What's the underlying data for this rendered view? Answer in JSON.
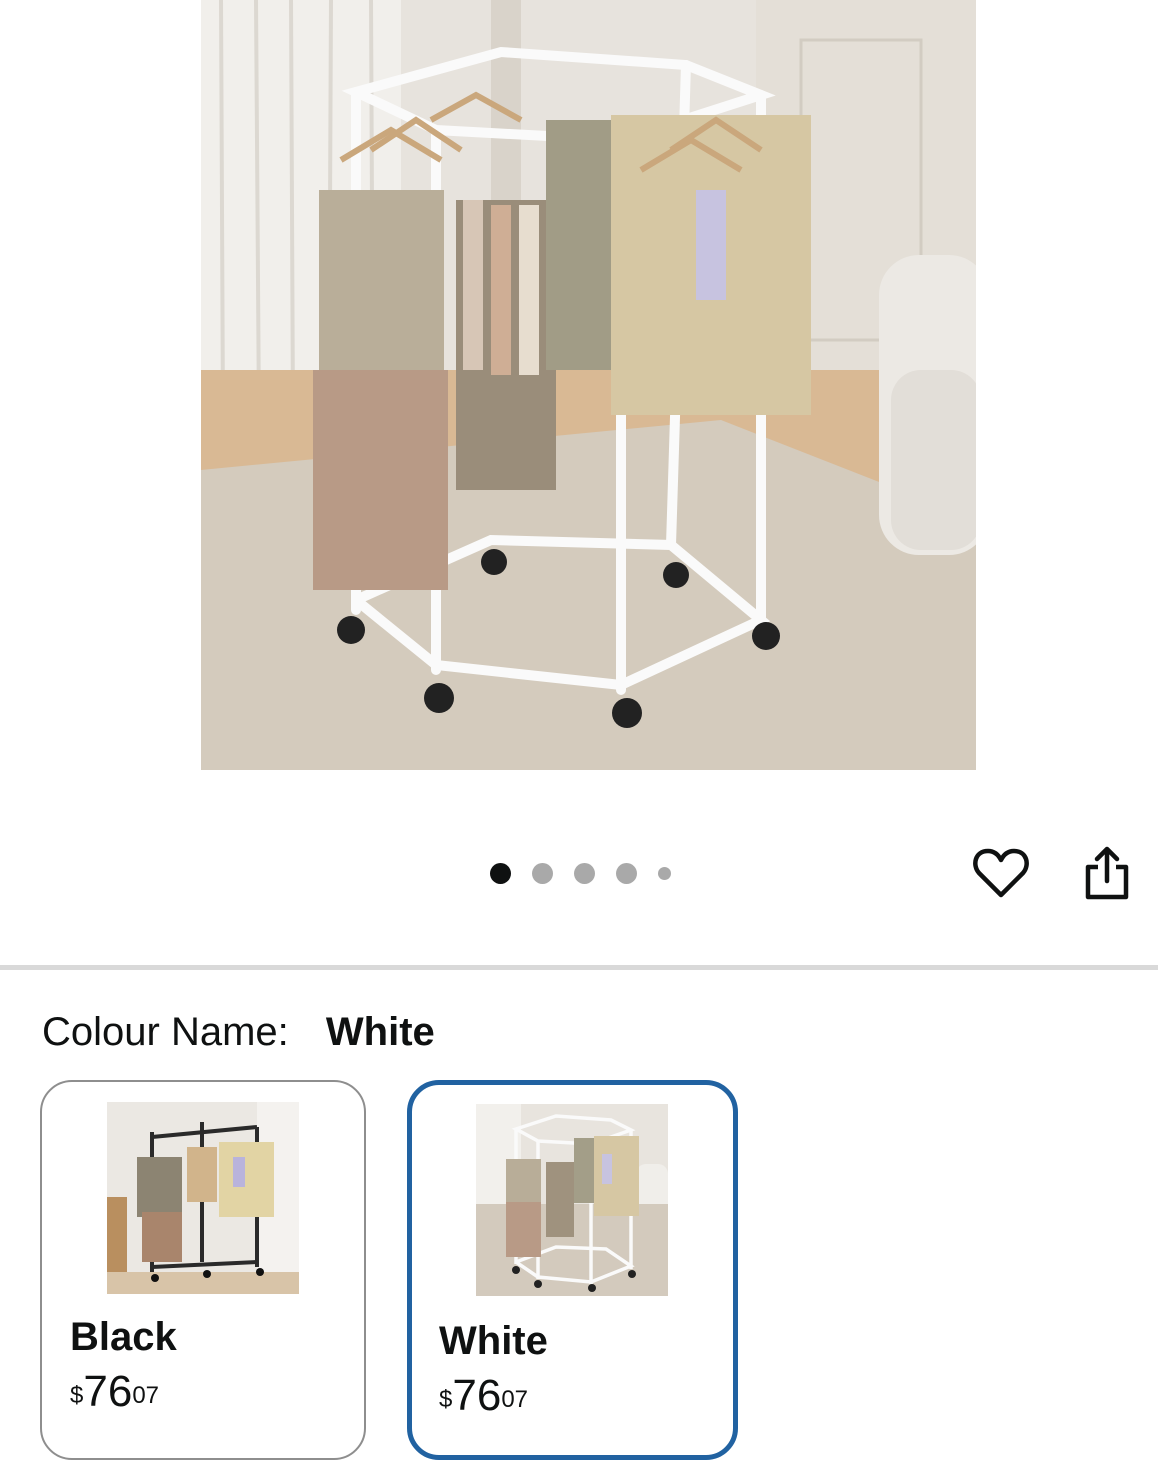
{
  "gallery": {
    "image_alt": "Hexagonal white clothes rack on wheels with hanging garments",
    "dots": [
      "active",
      "normal",
      "normal",
      "normal",
      "small"
    ]
  },
  "icons": {
    "favorite": "heart-icon",
    "share": "share-icon"
  },
  "variation": {
    "label": "Colour Name:",
    "selected": "White",
    "options": [
      {
        "name": "Black",
        "currency": "$",
        "dollars": "76",
        "cents": "07",
        "selected": false
      },
      {
        "name": "White",
        "currency": "$",
        "dollars": "76",
        "cents": "07",
        "selected": true
      }
    ]
  },
  "colors": {
    "selected_border": "#2162a1",
    "unselected_border": "#8e8e8e",
    "divider": "#d9d9d9"
  }
}
